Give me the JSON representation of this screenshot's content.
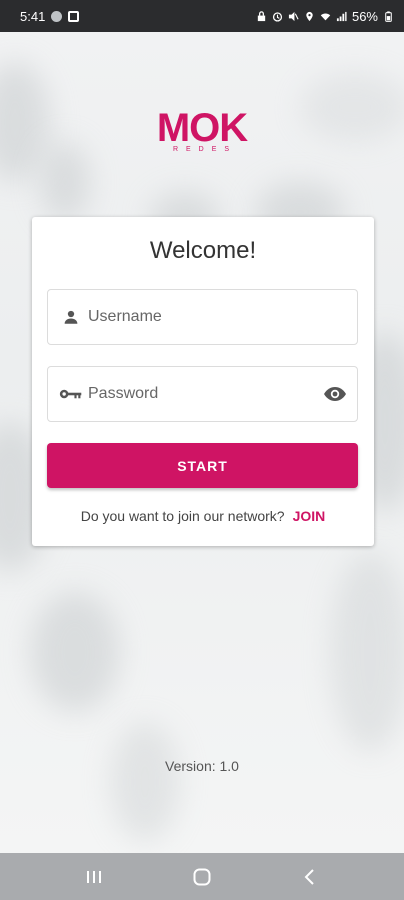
{
  "status_bar": {
    "time": "5:41",
    "battery": "56%"
  },
  "brand": {
    "logo": "MOK",
    "tagline": "REDES",
    "accent_color": "#cf1464"
  },
  "login_card": {
    "title": "Welcome!",
    "username": {
      "placeholder": "Username",
      "value": "",
      "icon": "person-icon"
    },
    "password": {
      "placeholder": "Password",
      "value": "",
      "icon": "key-icon",
      "toggle_icon": "eye-icon"
    },
    "start_label": "START",
    "join_prompt": "Do you want to join our network?",
    "join_label": "JOIN"
  },
  "footer": {
    "version": "Version: 1.0"
  },
  "nav_bar": {
    "buttons": [
      "recents-icon",
      "home-icon",
      "back-icon"
    ]
  }
}
